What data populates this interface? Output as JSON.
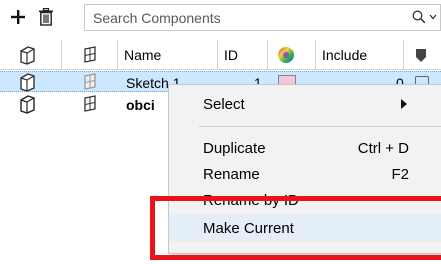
{
  "toolbar": {
    "add_icon": "plus-icon",
    "delete_icon": "trash-icon",
    "search_placeholder": "Search Components",
    "search_icon": "search-icon"
  },
  "table": {
    "columns": [
      "Name",
      "ID",
      "Include"
    ],
    "rows": [
      {
        "name": "Sketch 1",
        "id": "1",
        "include": "0",
        "selected": true
      },
      {
        "name": "obci",
        "id": "",
        "include": "",
        "selected": false
      }
    ]
  },
  "context_menu": {
    "items": [
      {
        "label": "Select",
        "shortcut": "",
        "submenu": true
      },
      {
        "label": "Duplicate",
        "shortcut": "Ctrl + D"
      },
      {
        "label": "Rename",
        "shortcut": "F2"
      },
      {
        "label": "Rename by ID",
        "shortcut": ""
      },
      {
        "label": "Make Current",
        "shortcut": ""
      }
    ]
  },
  "colors": {
    "selection": "#cce8ff",
    "menu_bg": "#f2f2f2",
    "highlight_box": "#e8141a"
  }
}
